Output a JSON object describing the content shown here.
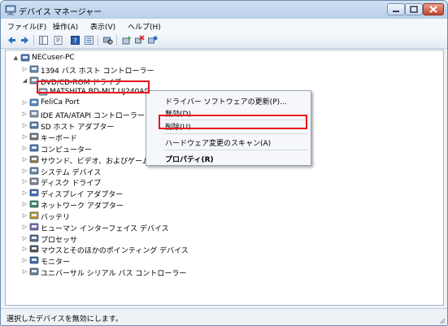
{
  "window": {
    "title": "デバイス マネージャー",
    "controls": {
      "minimize": "minimize-icon",
      "maximize": "maximize-icon",
      "close": "close-icon"
    }
  },
  "menubar": {
    "items": [
      "ファイル(F)",
      "操作(A)",
      "表示(V)",
      "ヘルプ(H)"
    ]
  },
  "toolbar": {
    "icons": [
      "back-arrow-icon",
      "forward-arrow-icon",
      "show-hide-tree-icon",
      "properties-icon",
      "help-icon",
      "view-icon",
      "scan-hardware-icon",
      "update-driver-icon",
      "disable-device-icon",
      "uninstall-device-icon"
    ]
  },
  "tree": {
    "root": "NECuser-PC",
    "items": [
      {
        "label": "1394 バス ホスト コントローラー",
        "icon": "bus-controller-icon",
        "expanded": false
      },
      {
        "label": "DVD/CD-ROM ドライブ",
        "icon": "dvd-drive-icon",
        "expanded": true,
        "children": [
          {
            "label": "MATSHITA BD-MLT UJ240AS",
            "icon": "optical-drive-icon",
            "selected": true
          }
        ]
      },
      {
        "label": "FeliCa Port",
        "icon": "felica-icon",
        "expanded": false
      },
      {
        "label": "IDE ATA/ATAPI コントローラー",
        "icon": "ide-controller-icon",
        "expanded": false
      },
      {
        "label": "SD ホスト アダプター",
        "icon": "sd-adapter-icon",
        "expanded": false
      },
      {
        "label": "キーボード",
        "icon": "keyboard-icon",
        "expanded": false
      },
      {
        "label": "コンピューター",
        "icon": "computer-icon",
        "expanded": false
      },
      {
        "label": "サウンド、ビデオ、およびゲーム",
        "icon": "sound-icon",
        "expanded": false
      },
      {
        "label": "システム デバイス",
        "icon": "system-device-icon",
        "expanded": false
      },
      {
        "label": "ディスク ドライブ",
        "icon": "disk-drive-icon",
        "expanded": false
      },
      {
        "label": "ディスプレイ アダプター",
        "icon": "display-adapter-icon",
        "expanded": false
      },
      {
        "label": "ネットワーク アダプター",
        "icon": "network-adapter-icon",
        "expanded": false
      },
      {
        "label": "バッテリ",
        "icon": "battery-icon",
        "expanded": false
      },
      {
        "label": "ヒューマン インターフェイス デバイス",
        "icon": "hid-icon",
        "expanded": false
      },
      {
        "label": "プロセッサ",
        "icon": "processor-icon",
        "expanded": false
      },
      {
        "label": "マウスとそのほかのポインティング デバイス",
        "icon": "mouse-icon",
        "expanded": false
      },
      {
        "label": "モニター",
        "icon": "monitor-icon",
        "expanded": false
      },
      {
        "label": "ユニバーサル シリアル バス コントローラー",
        "icon": "usb-controller-icon",
        "expanded": false
      }
    ]
  },
  "context_menu": {
    "items": [
      {
        "label": "ドライバー ソフトウェアの更新(P)...",
        "bold": false
      },
      {
        "label": "無効(D)",
        "bold": false
      },
      {
        "label": "削除(U)",
        "bold": false,
        "highlighted": true
      },
      {
        "label": "ハードウェア変更のスキャン(A)",
        "bold": false
      },
      {
        "label": "プロパティ(R)",
        "bold": true
      }
    ]
  },
  "statusbar": {
    "text": "選択したデバイスを無効にします。"
  },
  "colors": {
    "highlight_box": "#e8141c",
    "titlebar": "#c4d8ee",
    "tree_background": "#ffffff"
  }
}
